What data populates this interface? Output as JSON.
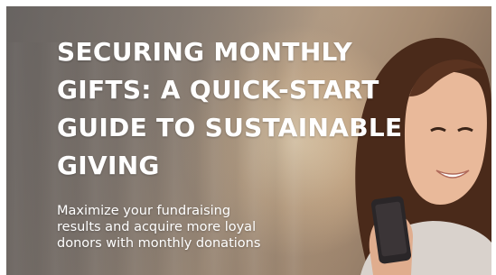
{
  "banner": {
    "headline_lines": [
      "SECURING MONTHLY",
      "GIFTS: A QUICK-START",
      "GUIDE TO SUSTAINABLE",
      "GIVING"
    ],
    "subtext_lines": [
      "Maximize your fundraising",
      "results and acquire more loyal",
      "donors with monthly donations"
    ],
    "image_subject": "woman-smiling-at-phone",
    "colors": {
      "text": "#ffffff",
      "overlay": "#7e7a77",
      "hair": "#4a2a1a",
      "skin": "#e9b99a",
      "phone": "#2a2628"
    }
  }
}
